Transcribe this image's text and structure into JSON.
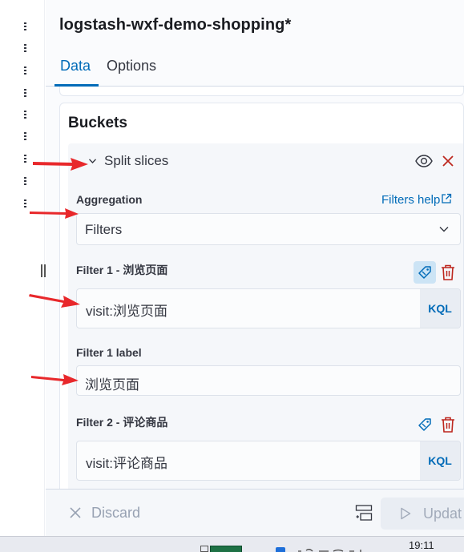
{
  "header": {
    "title": "logstash-wxf-demo-shopping*"
  },
  "tabs": [
    {
      "label": "Data",
      "active": true
    },
    {
      "label": "Options",
      "active": false
    }
  ],
  "buckets": {
    "title": "Buckets",
    "split_label": "Split slices",
    "aggregation_label": "Aggregation",
    "filters_help": "Filters help",
    "aggregation_value": "Filters",
    "filter1": {
      "title": "Filter 1 - 浏览页面",
      "query": "visit:浏览页面",
      "language": "KQL",
      "label_title": "Filter 1 label",
      "label_value": "浏览页面"
    },
    "filter2": {
      "title": "Filter 2 - 评论商品",
      "query": "visit:评论商品",
      "language": "KQL"
    }
  },
  "footer": {
    "discard_label": "Discard",
    "update_label": "Updat"
  },
  "taskbar": {
    "clock": "19:11"
  },
  "colors": {
    "accent": "#006bb8",
    "danger": "#bd271e",
    "arrow": "#e8282b"
  }
}
